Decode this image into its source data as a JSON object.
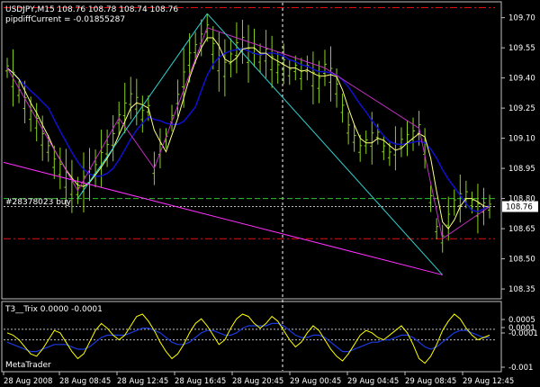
{
  "chart_data": [
    {
      "type": "candlestick-bars",
      "header": {
        "symbol_line": "USDJPY,M15  108.76  108.78  108.74  108.76",
        "indicator_line": "pipdiffCurrent = -0.01855287"
      },
      "price_axis": {
        "ticks": [
          "109.70",
          "109.55",
          "109.40",
          "109.25",
          "109.10",
          "108.95",
          "108.80",
          "108.65",
          "108.50",
          "108.35"
        ],
        "tick_values": [
          109.7,
          109.55,
          109.4,
          109.25,
          109.1,
          108.95,
          108.8,
          108.65,
          108.5,
          108.35
        ],
        "ylim": [
          108.31,
          109.77
        ],
        "current_price_label": "108.76",
        "current_price": 108.76
      },
      "order_line": {
        "label": "#28378023 buy",
        "price": 108.8
      },
      "red_levels": [
        109.75,
        108.6
      ],
      "bar_color": "#8bd11f",
      "ma_colors": {
        "fast": "#ffff80",
        "slow": "#1010d0"
      },
      "zigzag_color": "#c030c0",
      "channel_color": "#ff30ff",
      "trend_color": "#30d0d0",
      "close_series": [
        109.45,
        109.4,
        109.33,
        109.28,
        109.22,
        109.18,
        109.1,
        109.05,
        108.98,
        108.95,
        108.9,
        108.86,
        108.84,
        108.88,
        108.92,
        108.95,
        109.0,
        109.05,
        109.1,
        109.2,
        109.25,
        109.3,
        109.28,
        109.22,
        109.25,
        108.95,
        109.05,
        109.1,
        109.2,
        109.3,
        109.4,
        109.5,
        109.55,
        109.6,
        109.65,
        109.55,
        109.48,
        109.45,
        109.5,
        109.55,
        109.58,
        109.52,
        109.55,
        109.5,
        109.52,
        109.48,
        109.45,
        109.47,
        109.43,
        109.45,
        109.42,
        109.45,
        109.4,
        109.38,
        109.45,
        109.42,
        109.35,
        109.25,
        109.15,
        109.1,
        109.05,
        109.08,
        109.1,
        109.12,
        109.05,
        109.02,
        109.05,
        109.08,
        109.1,
        109.12,
        109.15,
        109.05,
        108.8,
        108.65,
        108.6,
        108.7,
        108.78,
        108.8,
        108.82,
        108.78,
        108.75,
        108.76,
        108.76
      ]
    },
    {
      "type": "line",
      "title": "T3__Trix  0.0000  -0.0001",
      "yticks": [
        "0.0005",
        "0.0001",
        "-0.0001",
        "-0.001"
      ],
      "series_colors": {
        "trix": "#ffff00",
        "signal": "#1a3ae0"
      },
      "trix": [
        0.2,
        0.1,
        -0.1,
        -0.4,
        -0.7,
        -0.8,
        -0.5,
        -0.1,
        0.3,
        0.2,
        -0.2,
        -0.6,
        -0.9,
        -0.7,
        -0.2,
        0.3,
        0.6,
        0.4,
        0.1,
        -0.1,
        0.1,
        0.5,
        0.9,
        1.0,
        0.7,
        0.3,
        -0.2,
        -0.6,
        -0.9,
        -0.7,
        -0.3,
        0.2,
        0.6,
        0.8,
        0.5,
        0.1,
        -0.3,
        -0.1,
        0.4,
        0.8,
        1.0,
        0.9,
        0.6,
        0.4,
        0.6,
        0.9,
        0.7,
        0.3,
        -0.1,
        -0.4,
        -0.2,
        0.2,
        0.5,
        0.3,
        -0.1,
        -0.5,
        -0.8,
        -1.0,
        -0.7,
        -0.3,
        0.1,
        0.3,
        0.2,
        0.0,
        -0.1,
        0.1,
        0.3,
        0.5,
        0.2,
        -0.3,
        -0.9,
        -1.1,
        -0.8,
        -0.3,
        0.3,
        0.7,
        1.0,
        0.8,
        0.4,
        0.1,
        -0.1,
        0.0,
        0.1
      ],
      "signal": [
        -0.2,
        -0.3,
        -0.4,
        -0.5,
        -0.6,
        -0.6,
        -0.5,
        -0.4,
        -0.3,
        -0.3,
        -0.3,
        -0.4,
        -0.5,
        -0.5,
        -0.4,
        -0.2,
        0.0,
        0.1,
        0.1,
        0.1,
        0.1,
        0.2,
        0.3,
        0.4,
        0.4,
        0.3,
        0.2,
        0.0,
        -0.2,
        -0.3,
        -0.3,
        -0.2,
        0.0,
        0.2,
        0.3,
        0.3,
        0.2,
        0.1,
        0.1,
        0.2,
        0.4,
        0.5,
        0.5,
        0.5,
        0.5,
        0.6,
        0.6,
        0.5,
        0.3,
        0.1,
        0.0,
        0.0,
        0.1,
        0.1,
        0.0,
        -0.2,
        -0.4,
        -0.6,
        -0.6,
        -0.5,
        -0.4,
        -0.3,
        -0.2,
        -0.2,
        -0.1,
        -0.1,
        0.0,
        0.1,
        0.1,
        0.0,
        -0.2,
        -0.4,
        -0.5,
        -0.4,
        -0.2,
        0.0,
        0.2,
        0.3,
        0.3,
        0.2,
        0.1,
        0.0,
        0.0
      ]
    }
  ],
  "x_axis_labels": [
    "28 Aug 2008",
    "28 Aug 08:45",
    "28 Aug 12:45",
    "28 Aug 16:45",
    "28 Aug 20:45",
    "29 Aug 00:45",
    "29 Aug 04:45",
    "29 Aug 08:45",
    "29 Aug 12:45"
  ],
  "watermark": "MetaTrader"
}
